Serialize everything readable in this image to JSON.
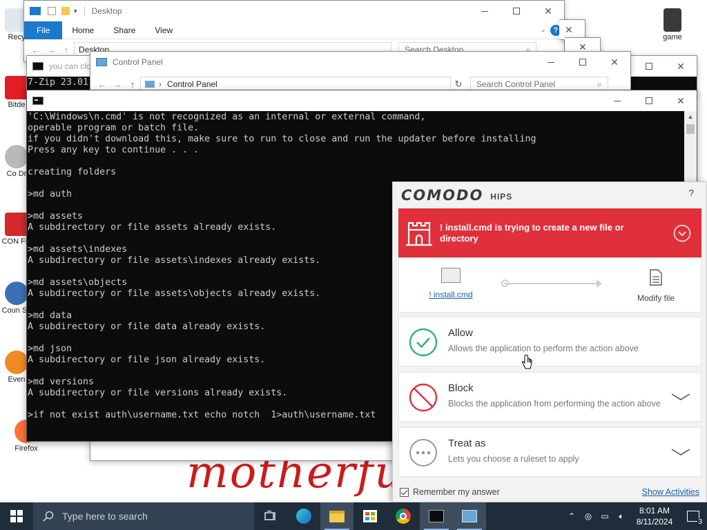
{
  "desktop": {
    "icons": [
      {
        "label": "Recy",
        "color": "#8aa6c4"
      },
      {
        "label": "Bitde",
        "color": "#e01e24"
      },
      {
        "label": "Co Dr",
        "color": "#b0b0b0"
      },
      {
        "label": "CON Fin",
        "color": "#d42a2a"
      },
      {
        "label": "Coun So",
        "color": "#3d6fb5"
      },
      {
        "label": "Even",
        "color": "#f08a24"
      },
      {
        "label": "Firefox",
        "color": "#ff7139"
      },
      {
        "label": "game",
        "color": "#3a3a3a"
      }
    ],
    "watermark": "motherfu"
  },
  "explorer_desktop": {
    "title": "Desktop",
    "ribbon_tabs": [
      "File",
      "Home",
      "Share",
      "View"
    ],
    "address": "Desktop",
    "search_placeholder": "Search Desktop"
  },
  "background_cmd": {
    "title": "you can clo",
    "line": "7-Zip 23.01"
  },
  "control_panel": {
    "title": "Control Panel",
    "address": "Control Panel",
    "search_placeholder": "Search Control Panel"
  },
  "console": {
    "lines": [
      "'C:\\Windows\\n.cmd' is not recognized as an internal or external command,",
      "operable program or batch file.",
      "if you didn't download this, make sure to run to close and run the updater before installing",
      "Press any key to continue . . .",
      "",
      "creating folders",
      "",
      ">md auth",
      "",
      ">md assets",
      "A subdirectory or file assets already exists.",
      "",
      ">md assets\\indexes",
      "A subdirectory or file assets\\indexes already exists.",
      "",
      ">md assets\\objects",
      "A subdirectory or file assets\\objects already exists.",
      "",
      ">md data",
      "A subdirectory or file data already exists.",
      "",
      ">md json",
      "A subdirectory or file json already exists.",
      "",
      ">md versions",
      "A subdirectory or file versions already exists.",
      "",
      ">if not exist auth\\username.txt echo notch  1>auth\\username.txt"
    ]
  },
  "comodo": {
    "logo": "COMODO",
    "product": "HIPS",
    "help": "?",
    "alert": "! install.cmd is trying to create a new file or directory",
    "source_link": "! install.cmd",
    "target_label": "Modify file",
    "options": [
      {
        "title": "Allow",
        "desc": "Allows the application to perform the action above"
      },
      {
        "title": "Block",
        "desc": "Blocks the application from performing the action above"
      },
      {
        "title": "Treat as",
        "desc": "Lets you choose a ruleset to apply"
      }
    ],
    "remember": "Remember my answer",
    "show_activities": "Show Activities",
    "accent": "#e0303b",
    "allow_color": "#2bb673",
    "block_color": "#e0303b"
  },
  "taskbar": {
    "search_placeholder": "Type here to search",
    "time": "8:01 AM",
    "date": "8/11/2024",
    "notification_count": "3"
  }
}
